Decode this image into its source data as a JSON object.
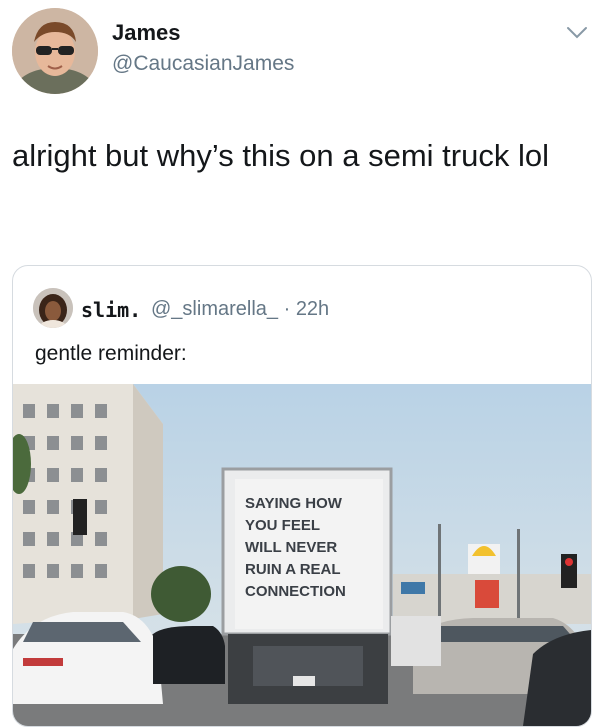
{
  "author": {
    "name": "James",
    "handle": "@CaucasianJames"
  },
  "tweet": {
    "text": "alright but why’s this on a semi truck lol"
  },
  "quoted": {
    "name": "slim.",
    "handle": "@_slimarella_",
    "sep": "·",
    "time": "22h",
    "text": "gentle reminder:",
    "truck_sign": [
      "SAYING HOW",
      "YOU FEEL",
      "WILL NEVER",
      "RUIN A REAL",
      "CONNECTION"
    ]
  },
  "colors": {
    "text": "#14171a",
    "muted": "#657786",
    "border": "#d6dbe0"
  },
  "icons": {
    "menu": "chevron-down-icon"
  }
}
